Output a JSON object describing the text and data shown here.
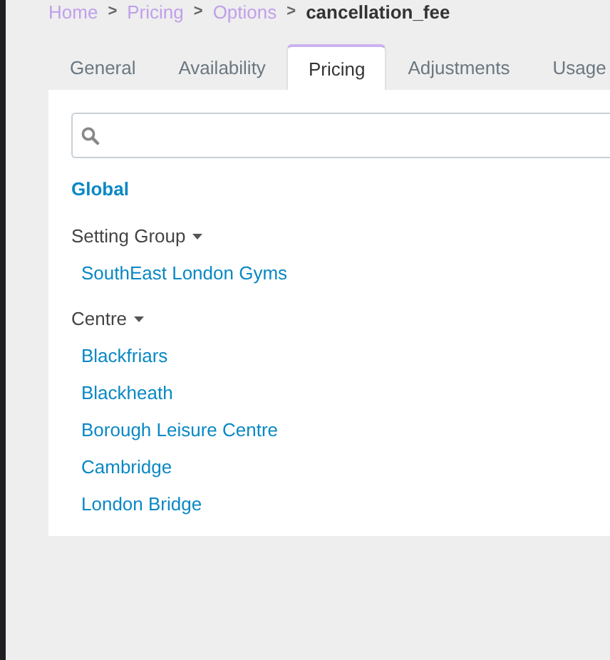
{
  "breadcrumb": [
    {
      "label": "Home",
      "current": false
    },
    {
      "label": "Pricing",
      "current": false
    },
    {
      "label": "Options",
      "current": false
    },
    {
      "label": "cancellation_fee",
      "current": true
    }
  ],
  "breadcrumb_separator": ">",
  "tabs": [
    {
      "label": "General",
      "selected": false
    },
    {
      "label": "Availability",
      "selected": false
    },
    {
      "label": "Pricing",
      "selected": true
    },
    {
      "label": "Adjustments",
      "selected": false
    },
    {
      "label": "Usage",
      "selected": false
    }
  ],
  "global_link": "Global",
  "groups": [
    {
      "title": "Setting Group",
      "expanded": true,
      "items": [
        "SouthEast London Gyms"
      ]
    },
    {
      "title": "Centre",
      "expanded": true,
      "items": [
        "Blackfriars",
        "Blackheath",
        "Borough Leisure Centre",
        "Cambridge",
        "London Bridge"
      ]
    }
  ]
}
